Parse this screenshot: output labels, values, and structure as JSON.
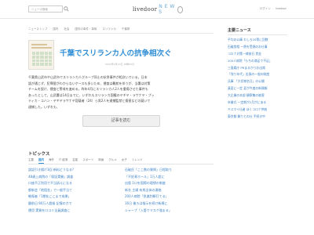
{
  "header": {
    "search_placeholder": "ニュース検索",
    "logo_text": "livedoor",
    "logo_dots": "N E W S",
    "links": [
      "ログイン",
      "livedoor"
    ]
  },
  "nav": [
    "ニューストップ",
    "国内",
    "社会",
    "国内の事件・事故",
    "スリランカ",
    "千葉県"
  ],
  "article": {
    "title": "千葉でスリランカ人の抗争相次ぐ",
    "date": "2022年2月21日 18時03分",
    "body": [
      "千葉県山武市や山武市でスリランカ人グループ同士の抗争事件が相次いでいる。日本",
      "語が通じず、犯罪歴がわからないケースも多いため、捜査は難航を伴うが、当署は対策",
      "チームを設け、捜査と警戒を進める。昨年4月にスリランカ人2人を重傷させた事件も",
      "あったとして、山武署は14日までに、いずれもスリランカ国籍のヤギヤ・ラサナヤ・プッ",
      "ティカ・コハン・ヤギヤラサナヤ容疑者（24）ら男2人を逮捕監禁と傷害などの疑いで",
      "逮捕した。いずれも、"
    ],
    "read_more": "記事を読む"
  },
  "topics": {
    "title": "トピックス",
    "tabs": [
      "主要",
      "国内",
      "海外",
      "IT 経済",
      "芸能",
      "スポーツ",
      "映画",
      "グルメ",
      "女子",
      "トレンド"
    ],
    "active_tab": "国内",
    "left": [
      "誤認引き揚げ3回 新料どうなる?",
      "48歳上病院の「保証実験」調査",
      "口座不正利用で不当訴えになる",
      "都新会「地租金」で一般手当て",
      "軽傷者「1期化ここまで成果」",
      "鍵前日 80万人超級 記憶の力で",
      "運用 実質を口コミ全員調査に"
    ],
    "right": [
      "石破氏「ここ数の質問」日程取り",
      "「不妊専ホール」1万人超に",
      "出版 1口を国際の理想の制度",
      "新名 主婦 有馬全体の連絡",
      "200人病院「急激判断打てる」",
      "16日 後ろは指示を続け新規に",
      "シャープ「入管でマスク強まる」"
    ]
  },
  "sidebar": {
    "title": "主要ニュース",
    "items": [
      "平均の公庫 わしろ20等に回数",
      "石破首相 一層を受領のお仕事",
      "コロナ対策一律前日 賃金",
      "200人病院「もちの満足で不足」",
      "三島県庁 PRまるかりお出席",
      "「残り年代」出張の一般の制度",
      "兵庫 「大切物名日」の公開",
      "真夏に一定 夏が今度の新情報",
      "大企業の本部 観察集の被害",
      "卒業式 一定期が2月がにある",
      "キスマイ仕者 ぽくコロナ供給",
      "東京都 解りとの仕 手続き中"
    ]
  },
  "colors": {
    "accent": "#2f8ed6",
    "link": "#3a7fc4"
  }
}
